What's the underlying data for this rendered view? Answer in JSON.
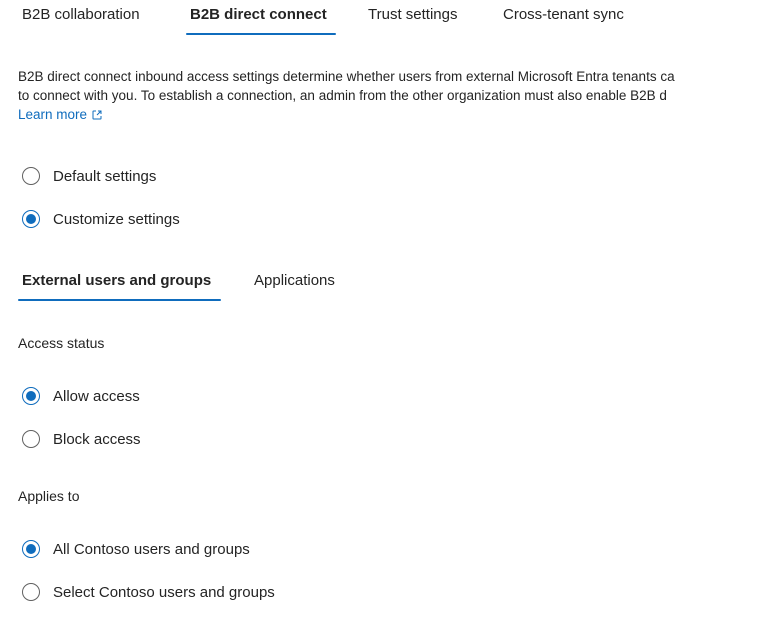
{
  "top_tabs": [
    {
      "label": "B2B collaboration",
      "active": false
    },
    {
      "label": "B2B direct connect",
      "active": true
    },
    {
      "label": "Trust settings",
      "active": false
    },
    {
      "label": "Cross-tenant sync",
      "active": false
    }
  ],
  "description": {
    "line1": "B2B direct connect inbound access settings determine whether users from external Microsoft Entra tenants ca",
    "line2": "to connect with you. To establish a connection, an admin from the other organization must also enable B2B d",
    "learn_more": "Learn more"
  },
  "settings_mode": {
    "options": [
      {
        "label": "Default settings",
        "checked": false
      },
      {
        "label": "Customize settings",
        "checked": true
      }
    ]
  },
  "sub_tabs": [
    {
      "label": "External users and groups",
      "active": true
    },
    {
      "label": "Applications",
      "active": false
    }
  ],
  "access_status": {
    "label": "Access status",
    "options": [
      {
        "label": "Allow access",
        "checked": true
      },
      {
        "label": "Block access",
        "checked": false
      }
    ]
  },
  "applies_to": {
    "label": "Applies to",
    "options": [
      {
        "label": "All Contoso users and groups",
        "checked": true
      },
      {
        "label": "Select Contoso users and groups",
        "checked": false
      }
    ]
  },
  "colors": {
    "accent": "#0f6cbd",
    "text": "#242424",
    "radio_border": "#616161"
  }
}
